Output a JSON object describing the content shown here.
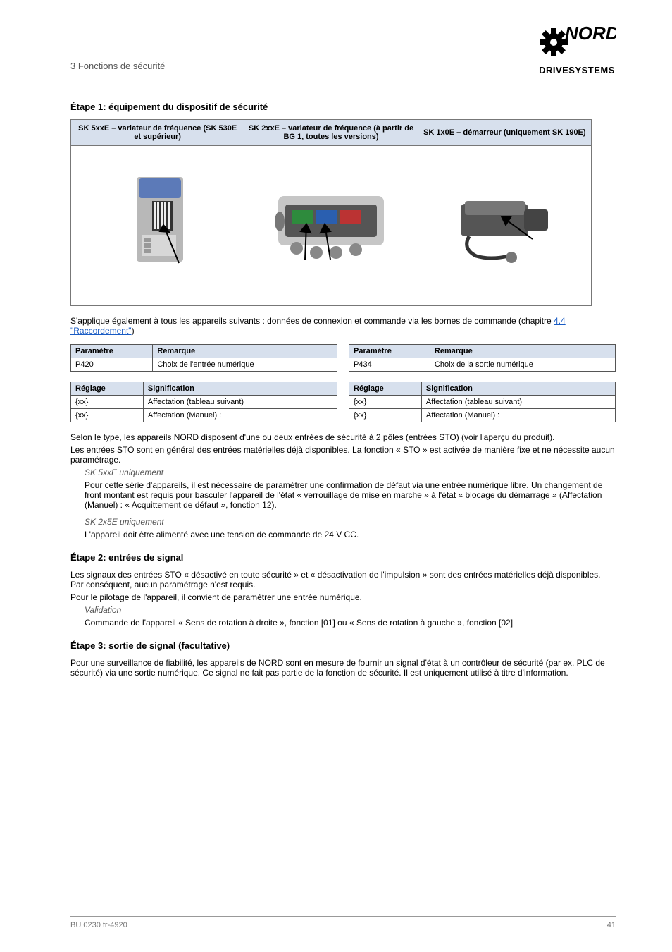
{
  "header": {
    "breadcrumb": "3   Fonctions de sécurité",
    "logo_brand": "NORD",
    "logo_sub": "DRIVESYSTEMS"
  },
  "section1_title": "Étape 1: équipement du dispositif de sécurité",
  "device_table_headers": {
    "c1": "SK 5xxE – variateur de fréquence\n(SK 530E et supérieur)",
    "c2": "SK 2xxE – variateur de fréquence\n(à partir de BG 1, toutes les versions)",
    "c3": "SK 1x0E – démarreur\n(uniquement SK 190E)"
  },
  "apply_sentence_prefix": "S'applique également à tous les appareils suivants : données de connexion et commande via les bornes de commande (chapitre ",
  "apply_link": "4.4 \"Raccordement\"",
  "apply_sentence_suffix": ")",
  "param_tables": {
    "row1": {
      "left": {
        "head_p": "Paramètre",
        "head_v": "Remarque",
        "p": "P420",
        "v": "Choix de l'entrée numérique"
      },
      "right": {
        "head_p": "Paramètre",
        "head_v": "Remarque",
        "p": "P434",
        "v": "Choix de la sortie numérique"
      }
    },
    "row2": {
      "left": {
        "head_p": "Réglage",
        "head_v": "Signification",
        "r1_p": "{xx}",
        "r1_v": "Affectation (tableau suivant)",
        "r2_p": "{xx}",
        "r2_v": "Affectation (Manuel) :"
      },
      "right": {
        "head_p": "Réglage",
        "head_v": "Signification",
        "r1_p": "{xx}",
        "r1_v": "Affectation (tableau suivant)",
        "r2_p": "{xx}",
        "r2_v": "Affectation (Manuel) :"
      }
    }
  },
  "p1": "Selon le type, les appareils NORD disposent d'une ou deux entrées de sécurité à 2 pôles (entrées STO) (voir l'aperçu du produit).",
  "p2": "Les entrées STO sont en général des entrées matérielles déjà disponibles. La fonction « STO » est activée de manière fixe et ne nécessite aucun paramétrage.",
  "blocks": [
    {
      "label": "SK 5xxE uniquement",
      "text": "Pour cette série d'appareils, il est nécessaire de paramétrer une confirmation de défaut via une entrée numérique libre. Un changement de front montant est requis pour basculer l'appareil de l'état « verrouillage de mise en marche » à l'état « blocage du démarrage » (Affectation (Manuel) : « Acquittement de défaut », fonction 12)."
    },
    {
      "label": "SK 2x5E uniquement",
      "text": "L'appareil doit être alimenté avec une tension de commande de 24 V CC."
    }
  ],
  "section2_title": "Étape 2: entrées de signal",
  "p3": "Les signaux des entrées STO « désactivé en toute sécurité » et « désactivation de l'impulsion » sont des entrées matérielles déjà disponibles. Par conséquent,  aucun paramétrage n'est requis.",
  "p4": "Pour le pilotage de l'appareil, il convient de paramétrer une entrée numérique.",
  "subs": [
    {
      "label": "Validation",
      "text": "Commande de l'appareil « Sens de rotation à droite », fonction [01] ou « Sens de rotation à gauche », fonction [02]"
    }
  ],
  "section3_title": "Étape 3: sortie de signal (facultative)",
  "p5": "Pour une surveillance de fiabilité, les appareils de NORD sont en mesure de fournir un signal d'état à un contrôleur de sécurité (par ex. PLC de sécurité) via une sortie numérique. Ce signal ne fait pas partie de la fonction de sécurité. Il est uniquement utilisé à titre d'information.",
  "footer": {
    "left": "BU 0230 fr-4920",
    "right": "41"
  }
}
